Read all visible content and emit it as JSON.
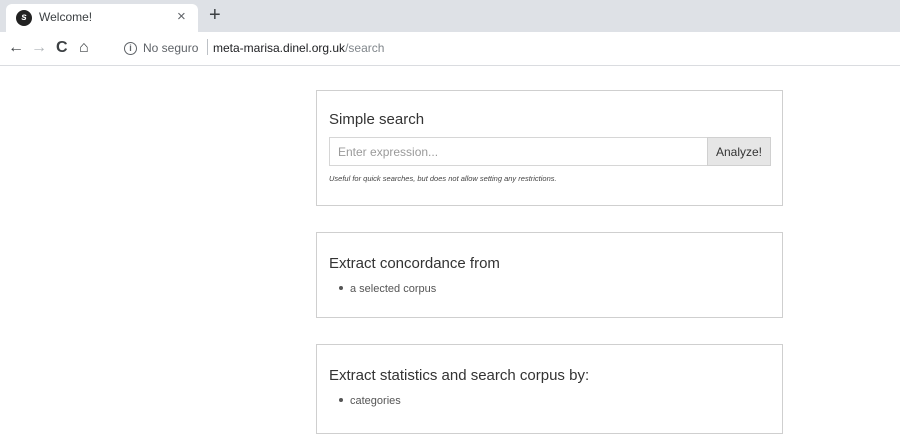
{
  "browser": {
    "tab": {
      "title": "Welcome!",
      "close_glyph": "×",
      "favicon": "symfony-icon"
    },
    "new_tab_glyph": "+",
    "nav": {
      "back": "←",
      "forward": "→",
      "reload": "C",
      "home": "⌂"
    },
    "address": {
      "security_text": "No seguro",
      "host": "meta-marisa.dinel.org.uk",
      "path": "/search"
    }
  },
  "simple_search": {
    "title": "Simple search",
    "placeholder": "Enter expression...",
    "button_label": "Analyze!",
    "help_text": "Useful for quick searches, but does not allow setting any restrictions."
  },
  "concordance": {
    "title": "Extract concordance from",
    "items": [
      "a selected corpus"
    ]
  },
  "statistics": {
    "title": "Extract statistics and search corpus by:",
    "items": [
      "categories"
    ]
  }
}
